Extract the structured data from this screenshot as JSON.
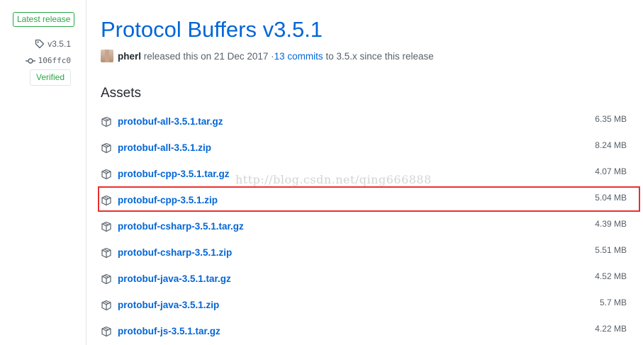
{
  "sidebar": {
    "latest_badge": "Latest release",
    "tag": "v3.5.1",
    "commit": "106ffc0",
    "verified": "Verified",
    "tag_icon": "tag-icon",
    "commit_icon": "git-commit-icon"
  },
  "release": {
    "title": "Protocol Buffers v3.5.1",
    "author": "pherl",
    "released_text": "released this on 21 Dec 2017 · ",
    "commits_link": "13 commits",
    "branch_text": "to 3.5.x since this release"
  },
  "assets": {
    "heading": "Assets",
    "icon": "package-icon",
    "items": [
      {
        "name": "protobuf-all-3.5.1.tar.gz",
        "size": "6.35 MB"
      },
      {
        "name": "protobuf-all-3.5.1.zip",
        "size": "8.24 MB"
      },
      {
        "name": "protobuf-cpp-3.5.1.tar.gz",
        "size": "4.07 MB"
      },
      {
        "name": "protobuf-cpp-3.5.1.zip",
        "size": "5.04 MB",
        "highlighted": true
      },
      {
        "name": "protobuf-csharp-3.5.1.tar.gz",
        "size": "4.39 MB"
      },
      {
        "name": "protobuf-csharp-3.5.1.zip",
        "size": "5.51 MB"
      },
      {
        "name": "protobuf-java-3.5.1.tar.gz",
        "size": "4.52 MB"
      },
      {
        "name": "protobuf-java-3.5.1.zip",
        "size": "5.7 MB"
      },
      {
        "name": "protobuf-js-3.5.1.tar.gz",
        "size": "4.22 MB"
      }
    ]
  },
  "watermark": "http://blog.csdn.net/qing666888",
  "colors": {
    "link": "#0366d6",
    "success": "#28a745",
    "muted": "#586069",
    "highlight_border": "#e8302f"
  }
}
